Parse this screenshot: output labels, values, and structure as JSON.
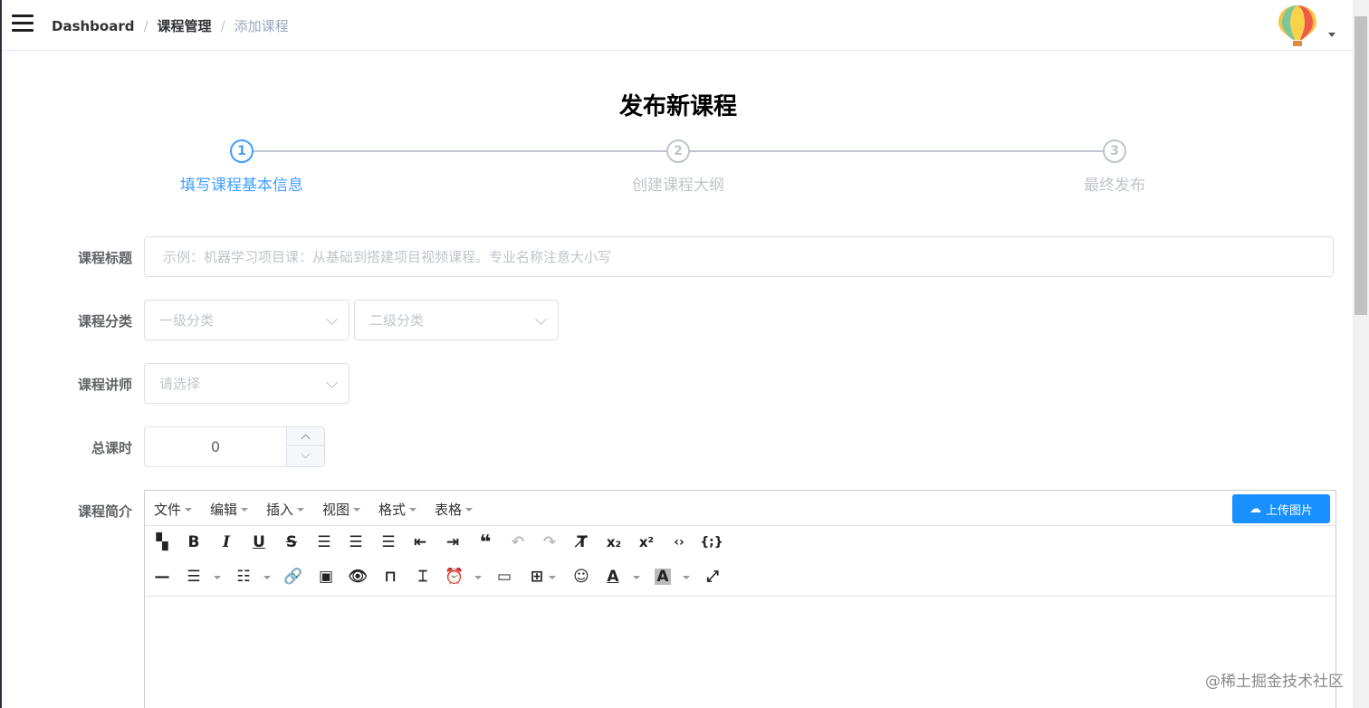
{
  "breadcrumb": {
    "root": "Dashboard",
    "section": "课程管理",
    "current": "添加课程",
    "separator": "/"
  },
  "page_title": "发布新课程",
  "steps": [
    {
      "number": "1",
      "label": "填写课程基本信息",
      "active": true
    },
    {
      "number": "2",
      "label": "创建课程大纲",
      "active": false
    },
    {
      "number": "3",
      "label": "最终发布",
      "active": false
    }
  ],
  "form": {
    "title_label": "课程标题",
    "title_placeholder": "示例：机器学习项目课：从基础到搭建项目视频课程。专业名称注意大小写",
    "category_label": "课程分类",
    "category_level1_placeholder": "一级分类",
    "category_level2_placeholder": "二级分类",
    "teacher_label": "课程讲师",
    "teacher_placeholder": "请选择",
    "hours_label": "总课时",
    "hours_value": "0",
    "intro_label": "课程简介"
  },
  "editor": {
    "menus": [
      "文件",
      "编辑",
      "插入",
      "视图",
      "格式",
      "表格"
    ],
    "upload_label": "上传图片",
    "toolbar_row1": [
      "find-replace",
      "bold",
      "italic",
      "underline",
      "strikethrough",
      "align-left",
      "align-center",
      "align-right",
      "outdent",
      "indent",
      "blockquote",
      "undo",
      "redo",
      "clear-format",
      "subscript",
      "superscript",
      "code",
      "code-sample"
    ],
    "toolbar_row2": [
      "horizontal-rule",
      "bullet-list",
      "numbered-list",
      "link",
      "image",
      "preview",
      "anchor",
      "page-break",
      "insert-datetime",
      "media",
      "table",
      "emoticons",
      "text-color",
      "background-color",
      "fullscreen"
    ]
  },
  "watermark": "@稀土掘金技术社区",
  "colors": {
    "primary": "#409eff",
    "upload_button": "#1890ff",
    "inactive": "#c0c4cc"
  }
}
